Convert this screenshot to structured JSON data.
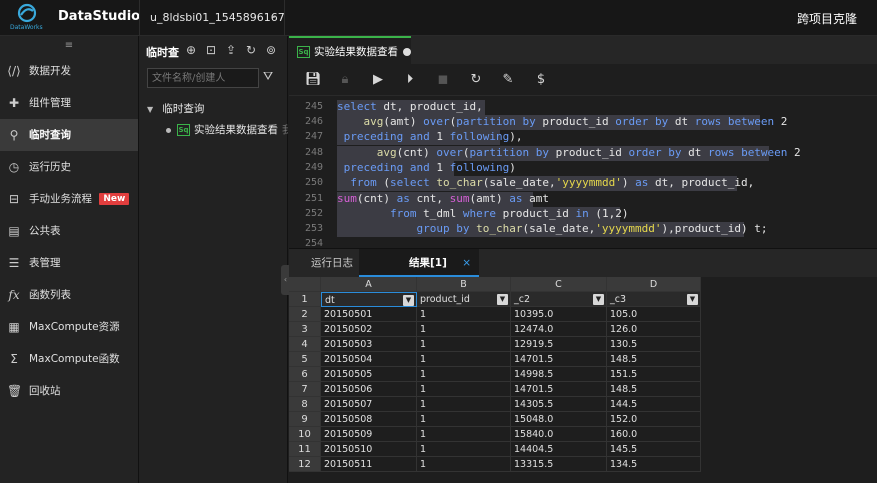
{
  "app": {
    "brand": "DataStudio",
    "logo_sub": "DataWorks",
    "project": "u_8ldsbi01_1545896167",
    "clone": "跨项目克隆"
  },
  "sidebar": {
    "items": [
      {
        "label": "数据开发",
        "icon": "code-icon"
      },
      {
        "label": "组件管理",
        "icon": "puzzle-icon"
      },
      {
        "label": "临时查询",
        "icon": "search-icon",
        "active": true
      },
      {
        "label": "运行历史",
        "icon": "clock-icon"
      },
      {
        "label": "手动业务流程",
        "icon": "workflow-icon",
        "badge": "New"
      },
      {
        "label": "公共表",
        "icon": "table-icon"
      },
      {
        "label": "表管理",
        "icon": "table-manage-icon"
      },
      {
        "label": "函数列表",
        "icon": "function-icon"
      },
      {
        "label": "MaxCompute资源",
        "icon": "resource-icon"
      },
      {
        "label": "MaxCompute函数",
        "icon": "sigma-icon"
      },
      {
        "label": "回收站",
        "icon": "trash-icon"
      }
    ]
  },
  "query_panel": {
    "title": "临时查",
    "search_placeholder": "文件名称/创建人",
    "folder": "临时查询",
    "file": "实验结果数据查看",
    "file_type": "Sq",
    "file_owner": "我"
  },
  "editor": {
    "tab_label": "实验结果数据查看",
    "tab_type": "Sq"
  },
  "results": {
    "tabs": [
      "运行日志",
      "结果[1]"
    ],
    "close": "×",
    "col_letters": [
      "A",
      "B",
      "C",
      "D"
    ],
    "fields": [
      "dt",
      "product_id",
      "_c2",
      "_c3"
    ],
    "rows": [
      [
        "20150501",
        "1",
        "10395.0",
        "105.0"
      ],
      [
        "20150502",
        "1",
        "12474.0",
        "126.0"
      ],
      [
        "20150503",
        "1",
        "12919.5",
        "130.5"
      ],
      [
        "20150504",
        "1",
        "14701.5",
        "148.5"
      ],
      [
        "20150505",
        "1",
        "14998.5",
        "151.5"
      ],
      [
        "20150506",
        "1",
        "14701.5",
        "148.5"
      ],
      [
        "20150507",
        "1",
        "14305.5",
        "144.5"
      ],
      [
        "20150508",
        "1",
        "15048.0",
        "152.0"
      ],
      [
        "20150509",
        "1",
        "15840.0",
        "160.0"
      ],
      [
        "20150510",
        "1",
        "14404.5",
        "145.5"
      ],
      [
        "20150511",
        "1",
        "13315.5",
        "134.5"
      ]
    ],
    "row_numbers": [
      "1",
      "2",
      "3",
      "4",
      "5",
      "6",
      "7",
      "8",
      "9",
      "10",
      "11",
      "12"
    ]
  }
}
